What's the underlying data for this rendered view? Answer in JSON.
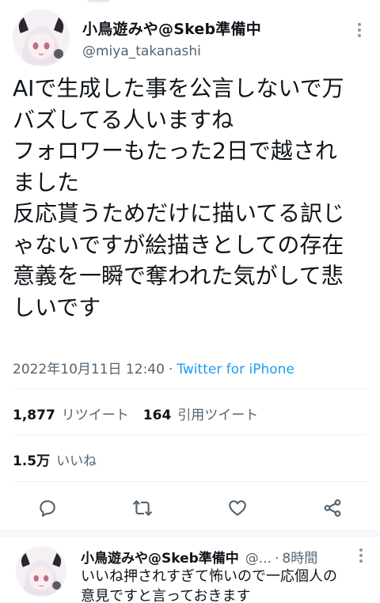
{
  "tweet": {
    "author_name": "小鳥遊みや@Skeb準備中",
    "author_handle": "@miya_takanashi",
    "text_lines": [
      "AIで生成した事を公言しないで万",
      "バズしてる人いますね",
      "フォロワーもたった2日で越され",
      "ました",
      "反応貰うためだけに描いてる訳じ",
      "ゃないですが絵描きとしての存在",
      "意義を一瞬で奪われた気がして悲",
      "しいです"
    ],
    "timestamp": "2022年10月11日 12:40",
    "separator": "·",
    "source": "Twitter for iPhone"
  },
  "stats": {
    "retweets_count": "1,877",
    "retweets_label": "リツイート",
    "quotes_count": "164",
    "quotes_label": "引用ツイート",
    "likes_count": "1.5万",
    "likes_label": "いいね"
  },
  "actions": [
    {
      "icon": "reply-icon"
    },
    {
      "icon": "retweet-icon"
    },
    {
      "icon": "like-icon"
    },
    {
      "icon": "share-icon"
    }
  ],
  "reply": {
    "author_name": "小鳥遊みや@Skeb準備中",
    "author_handle": "@...",
    "separator": "·",
    "time": "8時間",
    "text_lines": [
      "いいね押されすぎて怖いので一応個人の",
      "意見ですと言っておきます"
    ]
  },
  "colors": {
    "text": "#0f1419",
    "secondary": "#536471",
    "link": "#1d9bf0",
    "divider": "#eff3f4"
  }
}
